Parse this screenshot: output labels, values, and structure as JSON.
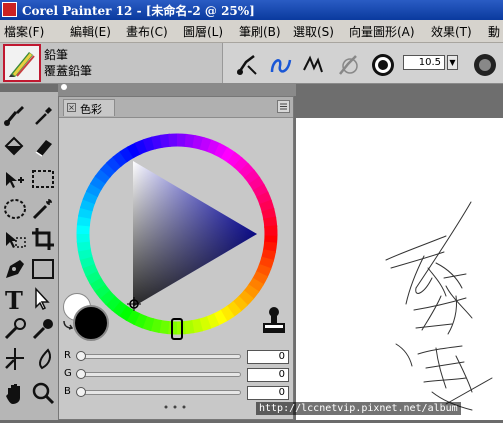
{
  "app": {
    "title": "Corel Painter 12 - [未命名-2 @ 25%]"
  },
  "menu": {
    "items": [
      {
        "label": "檔案(F)"
      },
      {
        "label": "編輯(E)"
      },
      {
        "label": "畫布(C)"
      },
      {
        "label": "圖層(L)"
      },
      {
        "label": "筆刷(B)"
      },
      {
        "label": "選取(S)"
      },
      {
        "label": "向量圖形(A)"
      },
      {
        "label": "效果(T)"
      },
      {
        "label": "動"
      }
    ]
  },
  "brush": {
    "category": "鉛筆",
    "variant": "覆蓋鉛筆",
    "size_value": "10.5"
  },
  "color_panel": {
    "tab_label": "色彩",
    "main_color": "#000000",
    "additional_color": "#ffffff",
    "sliders": [
      {
        "label": "R",
        "value": "0"
      },
      {
        "label": "G",
        "value": "0"
      },
      {
        "label": "B",
        "value": "0"
      }
    ]
  },
  "watermark": {
    "text": "http://lccnetvip.pixnet.net/album"
  },
  "colors": {
    "title_bar": "#0a3a9e",
    "brush_selector_border": "#c01830",
    "accent_blue": "#1a57d6"
  }
}
